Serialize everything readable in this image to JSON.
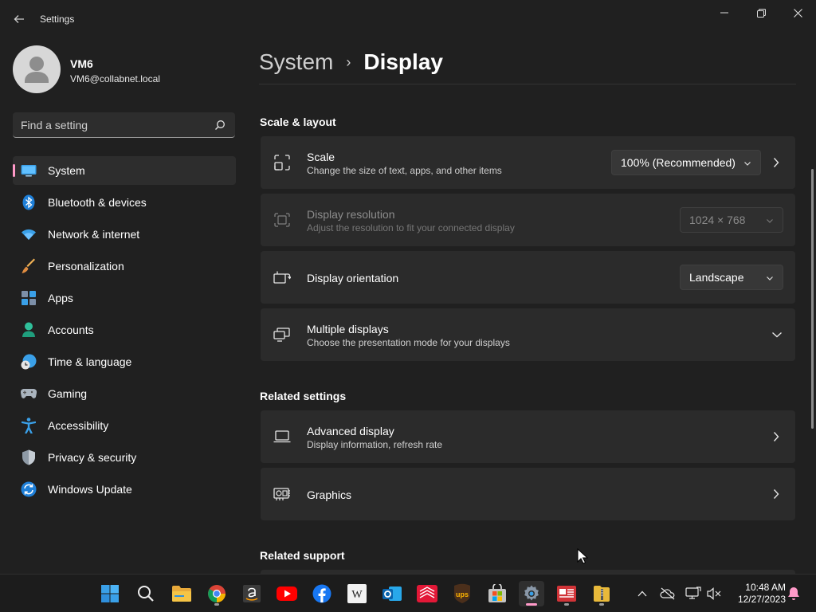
{
  "window": {
    "title": "Settings"
  },
  "user": {
    "name": "VM6",
    "email": "VM6@collabnet.local"
  },
  "search": {
    "placeholder": "Find a setting"
  },
  "sidebar": {
    "items": [
      {
        "label": "System",
        "icon": "monitor-icon",
        "active": true
      },
      {
        "label": "Bluetooth & devices",
        "icon": "bluetooth-icon"
      },
      {
        "label": "Network & internet",
        "icon": "wifi-icon"
      },
      {
        "label": "Personalization",
        "icon": "brush-icon"
      },
      {
        "label": "Apps",
        "icon": "apps-icon"
      },
      {
        "label": "Accounts",
        "icon": "person-icon"
      },
      {
        "label": "Time & language",
        "icon": "globe-clock-icon"
      },
      {
        "label": "Gaming",
        "icon": "gamepad-icon"
      },
      {
        "label": "Accessibility",
        "icon": "accessibility-icon"
      },
      {
        "label": "Privacy & security",
        "icon": "shield-icon"
      },
      {
        "label": "Windows Update",
        "icon": "update-icon"
      }
    ]
  },
  "breadcrumb": {
    "parent": "System",
    "separator": "›",
    "current": "Display"
  },
  "sections": {
    "scale_layout": "Scale & layout",
    "related_settings": "Related settings",
    "related_support": "Related support"
  },
  "cards": {
    "scale": {
      "title": "Scale",
      "subtitle": "Change the size of text, apps, and other items",
      "value": "100% (Recommended)",
      "icon": "scale-icon"
    },
    "resolution": {
      "title": "Display resolution",
      "subtitle": "Adjust the resolution to fit your connected display",
      "value": "1024 × 768",
      "disabled": true,
      "icon": "resolution-icon"
    },
    "orientation": {
      "title": "Display orientation",
      "value": "Landscape",
      "icon": "orientation-icon"
    },
    "multiple": {
      "title": "Multiple displays",
      "subtitle": "Choose the presentation mode for your displays",
      "icon": "multiple-displays-icon"
    },
    "advanced": {
      "title": "Advanced display",
      "subtitle": "Display information, refresh rate",
      "icon": "laptop-icon"
    },
    "graphics": {
      "title": "Graphics",
      "icon": "gpu-icon"
    }
  },
  "taskbar": {
    "apps": [
      "start-icon",
      "search-icon",
      "file-explorer-icon",
      "chrome-icon",
      "amazon-icon",
      "youtube-icon",
      "facebook-icon",
      "wikipedia-icon",
      "outlook-icon",
      "bank-of-america-icon",
      "ups-icon",
      "microsoft-store-icon",
      "settings-icon",
      "news-icon",
      "archive-icon"
    ],
    "wikipedia_letter": "W",
    "ups_letters": "ups",
    "time": "10:48 AM",
    "date": "12/27/2023"
  },
  "colors": {
    "background": "#202020",
    "card": "#2b2b2b",
    "accent": "#ff99c8",
    "taskbar": "#1c1c1c"
  }
}
